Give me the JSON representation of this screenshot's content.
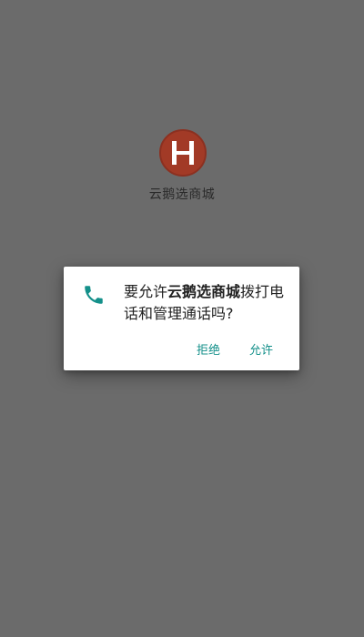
{
  "app": {
    "name": "云鹅选商城",
    "logo_letter": "H",
    "logo_color": "#a23a26"
  },
  "dialog": {
    "icon": "phone-icon",
    "message_prefix": "要允许",
    "message_app": "云鹅选商城",
    "message_suffix": "拨打电话和管理通话吗?",
    "deny_label": "拒绝",
    "allow_label": "允许",
    "accent_color": "#14908a"
  },
  "overlay_color": "#6b6b6b"
}
